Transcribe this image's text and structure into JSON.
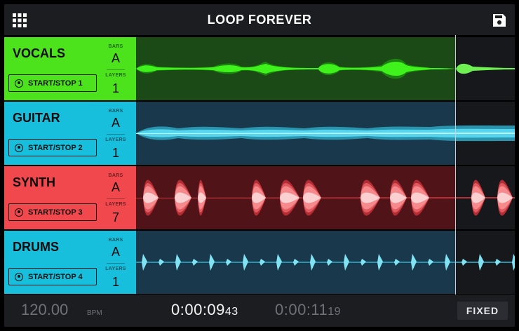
{
  "header": {
    "title": "LOOP FOREVER",
    "menu_icon": "grid-icon",
    "save_icon": "save-icon"
  },
  "labels": {
    "bars": "BARS",
    "layers": "LAYERS"
  },
  "tracks": [
    {
      "name": "VOCALS",
      "bars": "A",
      "layers": "1",
      "button": "START/STOP 1",
      "color": "#4ce21c",
      "wave_color": "#3ff21c",
      "bg": "#1b4a16"
    },
    {
      "name": "GUITAR",
      "bars": "A",
      "layers": "1",
      "button": "START/STOP 2",
      "color": "#17bfdc",
      "wave_color": "#56d6ee",
      "bg": "#19384c"
    },
    {
      "name": "SYNTH",
      "bars": "A",
      "layers": "7",
      "button": "START/STOP 3",
      "color": "#f0484c",
      "wave_color": "#f5898c",
      "bg": "#501418"
    },
    {
      "name": "DRUMS",
      "bars": "A",
      "layers": "1",
      "button": "START/STOP 4",
      "color": "#17bfdc",
      "wave_color": "#56d6ee",
      "bg": "#19384c"
    }
  ],
  "footer": {
    "bpm": "120.00",
    "bpm_unit": "BPM",
    "current_time": "0:00:09",
    "current_time_ms": "43",
    "total_time": "0:00:11",
    "total_time_ms": "19",
    "mode": "FIXED"
  }
}
